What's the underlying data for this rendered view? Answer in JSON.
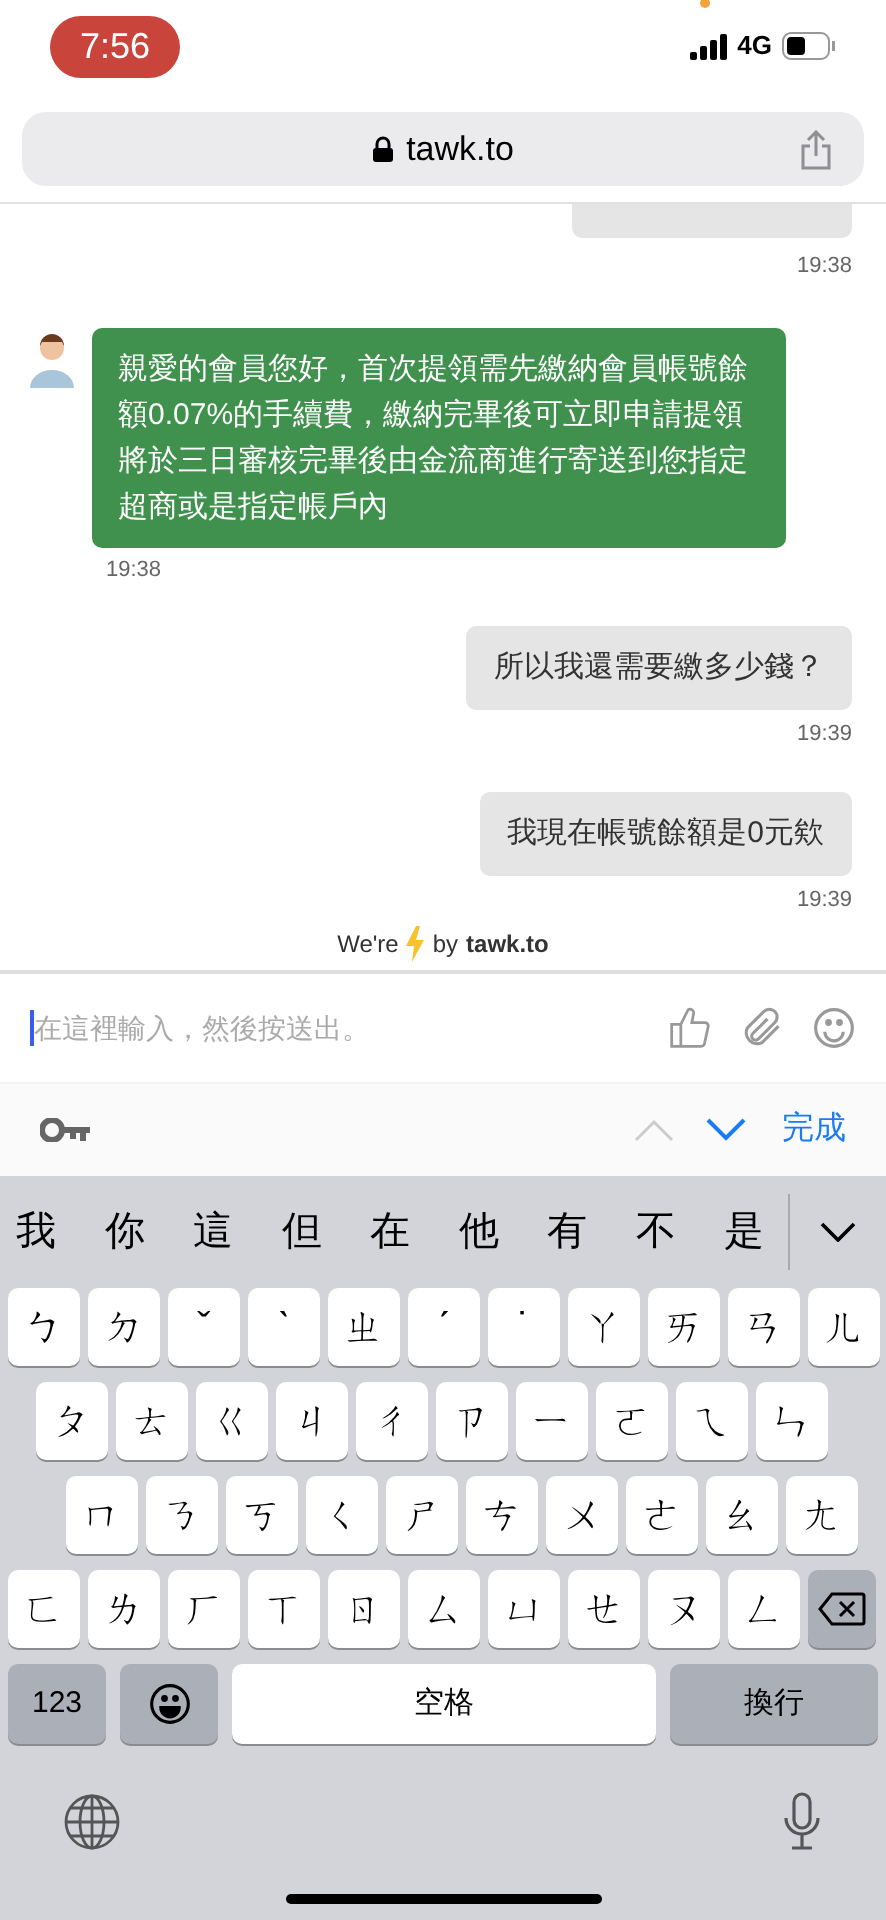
{
  "status_bar": {
    "time": "7:56",
    "network": "4G"
  },
  "browser": {
    "url": "tawk.to"
  },
  "messages": [
    {
      "kind": "cut",
      "time": "19:38"
    },
    {
      "kind": "agent",
      "text": "親愛的會員您好，首次提領需先繳納會員帳號餘額0.07%的手續費，繳納完畢後可立即申請提領將於三日審核完畢後由金流商進行寄送到您指定超商或是指定帳戶內",
      "time": "19:38"
    },
    {
      "kind": "visitor",
      "text": "所以我還需要繳多少錢？",
      "time": "19:39"
    },
    {
      "kind": "visitor",
      "text": "我現在帳號餘額是0元欸",
      "time": "19:39"
    }
  ],
  "branding": {
    "prefix": "We're",
    "suffix": "by",
    "brand": "tawk.to"
  },
  "composer": {
    "placeholder": "在這裡輸入，然後按送出。"
  },
  "keyboard_toolbar": {
    "done": "完成"
  },
  "candidates": [
    "我",
    "你",
    "這",
    "但",
    "在",
    "他",
    "有",
    "不",
    "是"
  ],
  "key_rows": [
    [
      "ㄅ",
      "ㄉ",
      "ˇ",
      "ˋ",
      "ㄓ",
      "ˊ",
      "˙",
      "ㄚ",
      "ㄞ",
      "ㄢ",
      "ㄦ"
    ],
    [
      "ㄆ",
      "ㄊ",
      "ㄍ",
      "ㄐ",
      "ㄔ",
      "ㄗ",
      "ㄧ",
      "ㄛ",
      "ㄟ",
      "ㄣ"
    ],
    [
      "ㄇ",
      "ㄋ",
      "ㄎ",
      "ㄑ",
      "ㄕ",
      "ㄘ",
      "ㄨ",
      "ㄜ",
      "ㄠ",
      "ㄤ"
    ],
    [
      "ㄈ",
      "ㄌ",
      "ㄏ",
      "ㄒ",
      "ㄖ",
      "ㄙ",
      "ㄩ",
      "ㄝ",
      "ㄡ",
      "ㄥ"
    ]
  ],
  "bottom_keys": {
    "numbers": "123",
    "space": "空格",
    "return": "換行"
  }
}
